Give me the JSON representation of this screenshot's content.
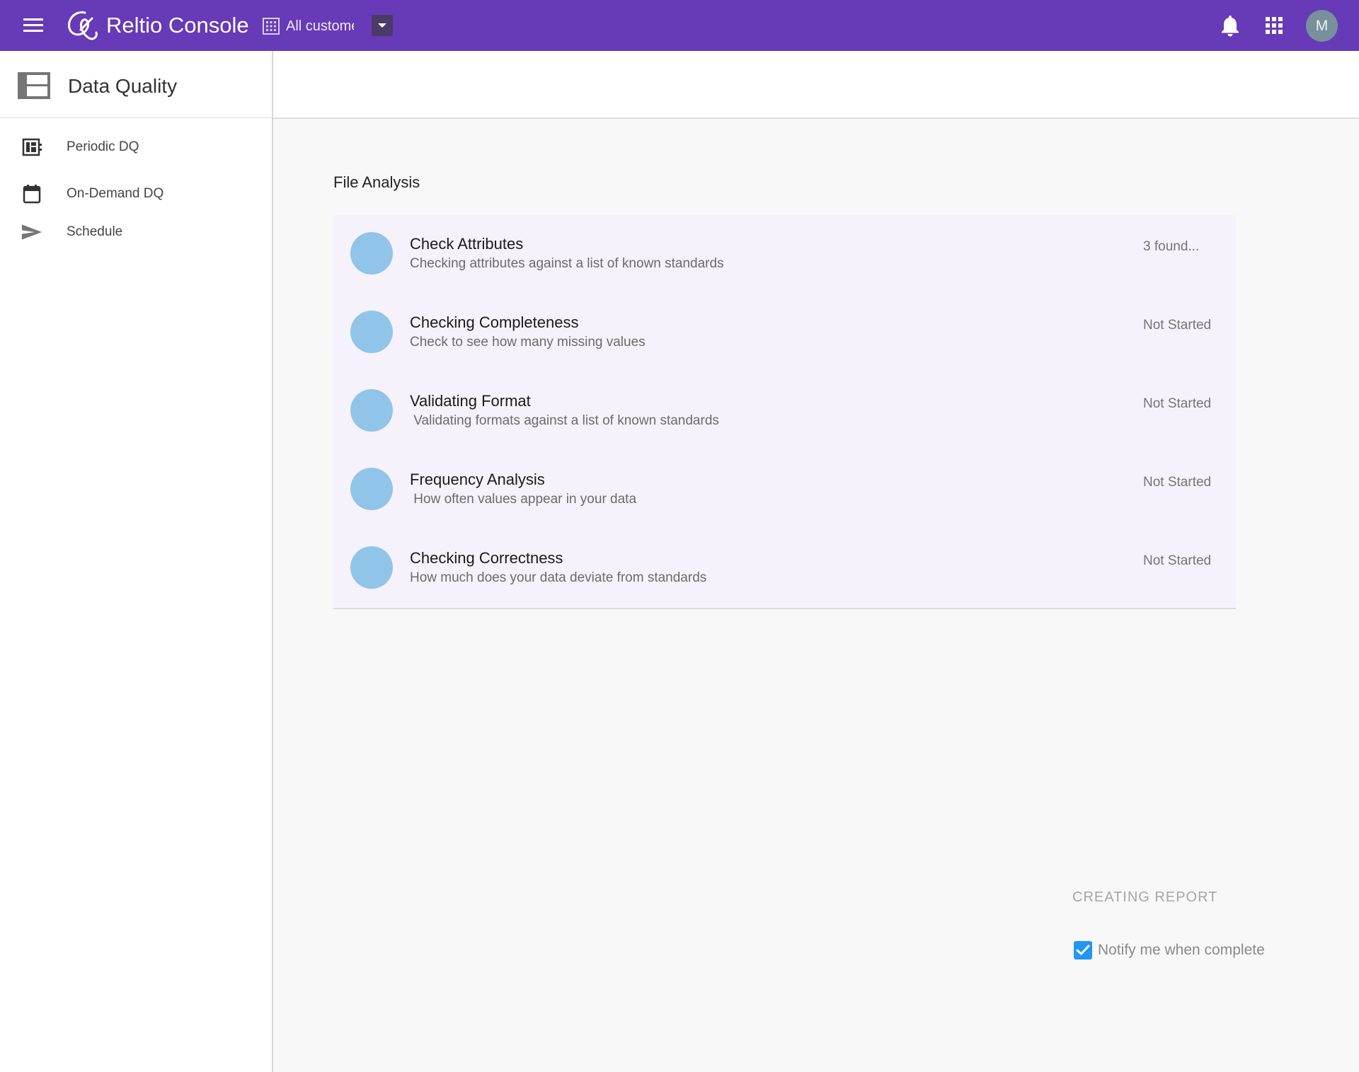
{
  "header": {
    "app_title": "Reltio Console",
    "tenant_label": "All customers",
    "avatar_initial": "M",
    "brand_color": "#673ab7"
  },
  "sidebar": {
    "title": "Data Quality",
    "items": [
      {
        "label": "Periodic DQ",
        "icon": "dashboard-icon"
      },
      {
        "label": "On-Demand DQ",
        "icon": "calendar-icon"
      },
      {
        "label": "Schedule",
        "icon": "send-icon"
      }
    ]
  },
  "main": {
    "section_title": "File Analysis",
    "steps": [
      {
        "title": "Check Attributes",
        "description": "Checking attributes against a list of known standards",
        "status": "3 found..."
      },
      {
        "title": "Checking Completeness",
        "description": "Check to see how many missing values",
        "status": "Not Started"
      },
      {
        "title": "Validating Format",
        "description": " Validating formats against a list of known standards",
        "status": "Not Started"
      },
      {
        "title": "Frequency Analysis",
        "description": " How often values appear in your data",
        "status": "Not Started"
      },
      {
        "title": "Checking Correctness",
        "description": "How much does your data deviate from standards",
        "status": "Not Started"
      }
    ],
    "report_status": "CREATING REPORT",
    "notify": {
      "label": "Notify me when complete",
      "checked": true
    }
  }
}
